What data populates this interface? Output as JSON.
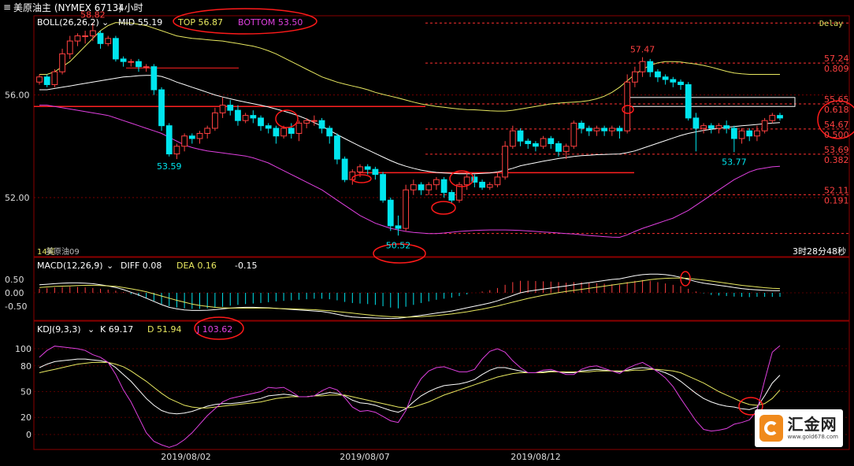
{
  "header": {
    "title": "美原油主 (NYMEX 6713)",
    "period": "4小时",
    "delay": "Delay"
  },
  "boll": {
    "label": "BOLL(26,26,2)",
    "mid": "MID 55.19",
    "top": "TOP 56.87",
    "bottom": "BOTTOM 53.50"
  },
  "macd": {
    "label": "MACD(12,26,9)",
    "diff": "DIFF 0.08",
    "dea": "DEA 0.16",
    "macd": "-0.15"
  },
  "kdj": {
    "label": "KDJ(9,3,3)",
    "k": "K 69.17",
    "d": "D 51.94",
    "j": "J 103.62"
  },
  "footer": {
    "left": "14笑",
    "contract": "美原油09",
    "countdown": "3时28分48秒"
  },
  "colors": {
    "up": "#ff4040",
    "down": "#00e5ee",
    "mid": "#ffffff",
    "top": "#e8e860",
    "bottom": "#e040e0",
    "fib": "#ff3030",
    "grid": "#7a0000"
  },
  "logo": {
    "name": "汇金网",
    "url": "www.gold678.com"
  },
  "chart_data": {
    "type": "candlestick",
    "dates": [
      "2019/08/02",
      "2019/08/07",
      "2019/08/12"
    ],
    "y_ticks": [
      "56.00",
      "52.00"
    ],
    "price_range": [
      49.7,
      58.9
    ],
    "annotations": [
      {
        "text": "58.82",
        "value": 58.82
      },
      {
        "text": "53.59",
        "value": 53.59
      },
      {
        "text": "50.52",
        "value": 50.52
      },
      {
        "text": "57.47",
        "value": 57.47
      },
      {
        "text": "53.77",
        "value": 53.77
      }
    ],
    "fib_levels": [
      {
        "price": "57.24",
        "ratio": "0.809",
        "value": 57.24
      },
      {
        "price": "55.65",
        "ratio": "0.618",
        "value": 55.65
      },
      {
        "price": "54.67",
        "ratio": "0.500",
        "value": 54.67
      },
      {
        "price": "53.69",
        "ratio": "0.382",
        "value": 53.69
      },
      {
        "price": "52.11",
        "ratio": "0.191",
        "value": 52.11
      }
    ],
    "candles": [
      [
        56.5,
        56.7,
        56.4,
        56.8
      ],
      [
        56.7,
        56.4,
        56.3,
        56.8
      ],
      [
        56.4,
        56.9,
        56.3,
        57.0
      ],
      [
        56.9,
        57.6,
        56.8,
        57.8
      ],
      [
        57.6,
        58.1,
        57.4,
        58.3
      ],
      [
        58.1,
        58.3,
        57.9,
        58.4
      ],
      [
        58.3,
        58.3,
        58.0,
        58.5
      ],
      [
        58.3,
        58.5,
        58.1,
        58.8
      ],
      [
        58.4,
        58.0,
        57.8,
        58.5
      ],
      [
        58.0,
        58.2,
        57.9,
        58.3
      ],
      [
        58.2,
        57.4,
        57.3,
        58.3
      ],
      [
        57.4,
        57.3,
        57.1,
        57.5
      ],
      [
        57.3,
        57.3,
        57.1,
        57.4
      ],
      [
        57.3,
        57.1,
        56.9,
        57.4
      ],
      [
        57.1,
        57.1,
        56.9,
        57.2
      ],
      [
        57.1,
        56.2,
        56.0,
        57.2
      ],
      [
        56.2,
        54.8,
        54.6,
        56.3
      ],
      [
        54.8,
        53.7,
        53.6,
        54.9
      ],
      [
        53.7,
        54.0,
        53.5,
        54.1
      ],
      [
        54.0,
        54.4,
        53.8,
        54.5
      ],
      [
        54.4,
        54.3,
        54.1,
        54.5
      ],
      [
        54.3,
        54.5,
        54.1,
        54.6
      ],
      [
        54.5,
        54.7,
        54.3,
        54.8
      ],
      [
        54.7,
        55.3,
        54.6,
        55.5
      ],
      [
        55.3,
        55.6,
        55.1,
        55.9
      ],
      [
        55.6,
        55.4,
        55.2,
        55.8
      ],
      [
        55.4,
        55.0,
        54.8,
        55.6
      ],
      [
        55.0,
        55.2,
        54.9,
        55.3
      ],
      [
        55.2,
        55.1,
        54.9,
        55.4
      ],
      [
        55.1,
        54.8,
        54.6,
        55.2
      ],
      [
        54.8,
        54.7,
        54.5,
        54.9
      ],
      [
        54.7,
        54.4,
        54.1,
        54.8
      ],
      [
        54.4,
        54.7,
        54.3,
        54.8
      ],
      [
        54.7,
        54.5,
        54.3,
        54.9
      ],
      [
        54.5,
        54.9,
        54.2,
        55.0
      ],
      [
        54.9,
        55.0,
        54.7,
        55.1
      ],
      [
        55.0,
        55.0,
        54.8,
        55.2
      ],
      [
        55.0,
        54.7,
        54.5,
        55.1
      ],
      [
        54.7,
        54.4,
        54.1,
        54.8
      ],
      [
        54.4,
        53.5,
        53.3,
        54.5
      ],
      [
        53.5,
        52.7,
        52.6,
        53.6
      ],
      [
        52.7,
        53.0,
        52.5,
        53.1
      ],
      [
        53.0,
        53.2,
        52.8,
        53.3
      ],
      [
        53.2,
        53.1,
        52.9,
        53.3
      ],
      [
        53.1,
        52.9,
        52.7,
        53.2
      ],
      [
        52.9,
        51.9,
        51.8,
        53.0
      ],
      [
        51.9,
        50.9,
        50.7,
        52.0
      ],
      [
        50.9,
        50.8,
        50.52,
        51.3
      ],
      [
        50.8,
        52.3,
        50.7,
        52.5
      ],
      [
        52.3,
        52.5,
        52.1,
        52.7
      ],
      [
        52.5,
        52.3,
        52.1,
        52.6
      ],
      [
        52.3,
        52.5,
        52.1,
        52.6
      ],
      [
        52.5,
        52.7,
        52.3,
        52.8
      ],
      [
        52.7,
        52.2,
        52.0,
        52.8
      ],
      [
        52.2,
        51.9,
        51.8,
        52.3
      ],
      [
        51.9,
        52.5,
        51.8,
        52.6
      ],
      [
        52.5,
        52.8,
        52.3,
        53.0
      ],
      [
        52.8,
        52.6,
        52.4,
        52.9
      ],
      [
        52.6,
        52.4,
        52.3,
        52.7
      ],
      [
        52.4,
        52.5,
        52.3,
        52.6
      ],
      [
        52.5,
        52.8,
        52.4,
        53.0
      ],
      [
        52.8,
        54.0,
        52.7,
        54.2
      ],
      [
        54.0,
        54.6,
        53.9,
        54.8
      ],
      [
        54.6,
        54.2,
        54.0,
        54.7
      ],
      [
        54.2,
        54.1,
        53.9,
        54.3
      ],
      [
        54.1,
        54.0,
        53.8,
        54.2
      ],
      [
        54.0,
        54.3,
        53.9,
        54.4
      ],
      [
        54.3,
        54.1,
        53.9,
        54.4
      ],
      [
        54.1,
        53.8,
        53.6,
        54.2
      ],
      [
        53.8,
        54.0,
        53.5,
        54.1
      ],
      [
        54.0,
        54.9,
        53.9,
        55.0
      ],
      [
        54.9,
        54.7,
        54.5,
        55.0
      ],
      [
        54.7,
        54.6,
        54.4,
        54.8
      ],
      [
        54.6,
        54.7,
        54.4,
        54.8
      ],
      [
        54.7,
        54.6,
        54.4,
        54.8
      ],
      [
        54.6,
        54.7,
        54.4,
        54.8
      ],
      [
        54.7,
        54.6,
        54.3,
        54.8
      ],
      [
        54.6,
        56.5,
        54.5,
        56.8
      ],
      [
        56.5,
        56.9,
        56.3,
        57.1
      ],
      [
        56.9,
        57.3,
        56.7,
        57.47
      ],
      [
        57.3,
        56.9,
        56.7,
        57.4
      ],
      [
        56.9,
        56.7,
        56.5,
        57.0
      ],
      [
        56.7,
        56.6,
        56.4,
        56.8
      ],
      [
        56.6,
        56.5,
        56.3,
        56.7
      ],
      [
        56.5,
        56.4,
        56.2,
        56.6
      ],
      [
        56.4,
        55.1,
        55.0,
        56.5
      ],
      [
        55.1,
        54.7,
        53.8,
        55.3
      ],
      [
        54.7,
        54.8,
        54.5,
        54.9
      ],
      [
        54.8,
        54.7,
        54.5,
        54.9
      ],
      [
        54.7,
        54.8,
        54.5,
        54.9
      ],
      [
        54.8,
        54.7,
        54.5,
        55.0
      ],
      [
        54.7,
        54.3,
        53.77,
        54.8
      ],
      [
        54.3,
        54.6,
        54.1,
        54.7
      ],
      [
        54.6,
        54.4,
        54.2,
        54.7
      ],
      [
        54.4,
        54.6,
        54.2,
        54.8
      ],
      [
        54.6,
        55.0,
        54.5,
        55.1
      ],
      [
        55.0,
        55.2,
        54.9,
        55.3
      ],
      [
        55.2,
        55.1,
        55.0,
        55.3
      ]
    ],
    "boll_mid": [
      56.2,
      56.2,
      56.25,
      56.3,
      56.35,
      56.4,
      56.45,
      56.5,
      56.55,
      56.6,
      56.65,
      56.7,
      56.72,
      56.75,
      56.76,
      56.76,
      56.72,
      56.62,
      56.5,
      56.4,
      56.3,
      56.2,
      56.1,
      56.0,
      55.92,
      55.85,
      55.78,
      55.72,
      55.66,
      55.6,
      55.53,
      55.45,
      55.37,
      55.28,
      55.18,
      55.06,
      54.92,
      54.78,
      54.62,
      54.46,
      54.3,
      54.15,
      54.0,
      53.86,
      53.72,
      53.58,
      53.44,
      53.32,
      53.22,
      53.14,
      53.07,
      53.02,
      52.98,
      52.96,
      52.94,
      52.93,
      52.93,
      52.93,
      52.94,
      52.96,
      53.0,
      53.06,
      53.14,
      53.24,
      53.3,
      53.36,
      53.42,
      53.47,
      53.52,
      53.56,
      53.6,
      53.63,
      53.65,
      53.67,
      53.68,
      53.69,
      53.7,
      53.75,
      53.82,
      53.92,
      54.02,
      54.12,
      54.22,
      54.32,
      54.42,
      54.5,
      54.56,
      54.62,
      54.66,
      54.7,
      54.74,
      54.77,
      54.8,
      54.82,
      54.85,
      54.88,
      54.9,
      54.92
    ],
    "boll_top": [
      56.8,
      56.8,
      56.9,
      57.1,
      57.3,
      57.6,
      57.9,
      58.2,
      58.5,
      58.7,
      58.82,
      58.8,
      58.8,
      58.75,
      58.7,
      58.6,
      58.5,
      58.4,
      58.3,
      58.25,
      58.2,
      58.18,
      58.15,
      58.12,
      58.1,
      58.05,
      58.0,
      57.95,
      57.9,
      57.82,
      57.72,
      57.6,
      57.45,
      57.3,
      57.15,
      57.0,
      56.85,
      56.7,
      56.6,
      56.5,
      56.42,
      56.35,
      56.28,
      56.2,
      56.1,
      56.02,
      55.95,
      55.88,
      55.8,
      55.72,
      55.65,
      55.6,
      55.55,
      55.52,
      55.48,
      55.45,
      55.43,
      55.42,
      55.4,
      55.38,
      55.37,
      55.37,
      55.4,
      55.45,
      55.5,
      55.55,
      55.6,
      55.65,
      55.68,
      55.7,
      55.72,
      55.74,
      55.78,
      55.85,
      55.95,
      56.1,
      56.3,
      56.55,
      56.8,
      57.0,
      57.15,
      57.25,
      57.3,
      57.3,
      57.28,
      57.24,
      57.2,
      57.15,
      57.08,
      57.0,
      56.92,
      56.85,
      56.82,
      56.8,
      56.8,
      56.8,
      56.8,
      56.8
    ],
    "boll_bottom": [
      55.6,
      55.6,
      55.55,
      55.5,
      55.45,
      55.4,
      55.35,
      55.3,
      55.25,
      55.2,
      55.1,
      55.0,
      54.9,
      54.8,
      54.7,
      54.6,
      54.5,
      54.35,
      54.2,
      54.05,
      53.95,
      53.88,
      53.82,
      53.78,
      53.74,
      53.7,
      53.66,
      53.62,
      53.55,
      53.45,
      53.35,
      53.2,
      53.05,
      52.9,
      52.75,
      52.6,
      52.45,
      52.3,
      52.1,
      51.9,
      51.7,
      51.5,
      51.3,
      51.15,
      51.0,
      50.9,
      50.8,
      50.74,
      50.68,
      50.64,
      50.62,
      50.6,
      50.6,
      50.62,
      50.65,
      50.68,
      50.7,
      50.72,
      50.73,
      50.74,
      50.74,
      50.74,
      50.73,
      50.72,
      50.7,
      50.68,
      50.66,
      50.64,
      50.62,
      50.6,
      50.58,
      50.55,
      50.52,
      50.5,
      50.48,
      50.46,
      50.45,
      50.55,
      50.68,
      50.8,
      50.9,
      51.0,
      51.1,
      51.2,
      51.35,
      51.5,
      51.7,
      51.9,
      52.1,
      52.3,
      52.5,
      52.7,
      52.85,
      53.0,
      53.1,
      53.15,
      53.2,
      53.22
    ],
    "macd_hist": [
      0.15,
      0.18,
      0.2,
      0.22,
      0.23,
      0.22,
      0.2,
      0.18,
      0.15,
      0.12,
      0.08,
      0.03,
      -0.05,
      -0.12,
      -0.2,
      -0.3,
      -0.42,
      -0.5,
      -0.55,
      -0.58,
      -0.6,
      -0.6,
      -0.58,
      -0.56,
      -0.52,
      -0.48,
      -0.45,
      -0.42,
      -0.4,
      -0.38,
      -0.35,
      -0.32,
      -0.3,
      -0.28,
      -0.26,
      -0.24,
      -0.22,
      -0.22,
      -0.24,
      -0.28,
      -0.34,
      -0.38,
      -0.4,
      -0.42,
      -0.45,
      -0.5,
      -0.55,
      -0.58,
      -0.52,
      -0.45,
      -0.38,
      -0.32,
      -0.26,
      -0.22,
      -0.18,
      -0.12,
      -0.06,
      0.0,
      0.05,
      0.1,
      0.18,
      0.3,
      0.4,
      0.45,
      0.45,
      0.44,
      0.43,
      0.42,
      0.4,
      0.38,
      0.4,
      0.4,
      0.38,
      0.36,
      0.34,
      0.32,
      0.3,
      0.4,
      0.45,
      0.48,
      0.45,
      0.4,
      0.35,
      0.3,
      0.25,
      0.15,
      0.05,
      -0.02,
      -0.08,
      -0.1,
      -0.12,
      -0.14,
      -0.15,
      -0.16,
      -0.15,
      -0.15,
      -0.15,
      -0.15
    ],
    "macd_diff": [
      0.3,
      0.32,
      0.34,
      0.36,
      0.37,
      0.37,
      0.36,
      0.34,
      0.3,
      0.26,
      0.2,
      0.12,
      0.02,
      -0.08,
      -0.2,
      -0.32,
      -0.44,
      -0.54,
      -0.6,
      -0.64,
      -0.66,
      -0.66,
      -0.65,
      -0.63,
      -0.6,
      -0.57,
      -0.55,
      -0.54,
      -0.54,
      -0.55,
      -0.56,
      -0.58,
      -0.6,
      -0.62,
      -0.64,
      -0.66,
      -0.68,
      -0.7,
      -0.74,
      -0.8,
      -0.86,
      -0.9,
      -0.92,
      -0.93,
      -0.94,
      -0.95,
      -0.96,
      -0.95,
      -0.92,
      -0.88,
      -0.84,
      -0.8,
      -0.76,
      -0.72,
      -0.68,
      -0.62,
      -0.56,
      -0.5,
      -0.44,
      -0.38,
      -0.3,
      -0.2,
      -0.1,
      0.0,
      0.06,
      0.1,
      0.14,
      0.18,
      0.22,
      0.26,
      0.3,
      0.34,
      0.38,
      0.42,
      0.46,
      0.5,
      0.52,
      0.58,
      0.64,
      0.68,
      0.7,
      0.7,
      0.68,
      0.64,
      0.58,
      0.5,
      0.42,
      0.36,
      0.32,
      0.28,
      0.24,
      0.2,
      0.16,
      0.13,
      0.11,
      0.09,
      0.08,
      0.08
    ],
    "macd_dea": [
      0.2,
      0.22,
      0.24,
      0.25,
      0.26,
      0.27,
      0.28,
      0.28,
      0.27,
      0.26,
      0.24,
      0.2,
      0.15,
      0.1,
      0.04,
      -0.04,
      -0.12,
      -0.2,
      -0.28,
      -0.35,
      -0.42,
      -0.47,
      -0.51,
      -0.54,
      -0.56,
      -0.57,
      -0.57,
      -0.57,
      -0.57,
      -0.57,
      -0.57,
      -0.58,
      -0.59,
      -0.6,
      -0.61,
      -0.62,
      -0.63,
      -0.65,
      -0.67,
      -0.7,
      -0.73,
      -0.76,
      -0.79,
      -0.82,
      -0.85,
      -0.87,
      -0.89,
      -0.9,
      -0.91,
      -0.9,
      -0.89,
      -0.87,
      -0.85,
      -0.82,
      -0.79,
      -0.75,
      -0.71,
      -0.66,
      -0.61,
      -0.55,
      -0.49,
      -0.42,
      -0.35,
      -0.28,
      -0.21,
      -0.15,
      -0.09,
      -0.04,
      0.01,
      0.05,
      0.09,
      0.13,
      0.17,
      0.21,
      0.25,
      0.29,
      0.33,
      0.37,
      0.41,
      0.45,
      0.49,
      0.52,
      0.54,
      0.55,
      0.55,
      0.54,
      0.51,
      0.48,
      0.44,
      0.4,
      0.36,
      0.32,
      0.28,
      0.25,
      0.22,
      0.19,
      0.17,
      0.16
    ],
    "kdj_k": [
      78,
      82,
      85,
      86,
      87,
      88,
      88,
      87,
      86,
      84,
      78,
      70,
      62,
      52,
      42,
      34,
      28,
      25,
      24,
      25,
      27,
      30,
      33,
      35,
      36,
      36,
      37,
      38,
      40,
      42,
      45,
      46,
      47,
      46,
      44,
      44,
      45,
      47,
      49,
      48,
      45,
      40,
      37,
      36,
      34,
      31,
      28,
      26,
      30,
      38,
      45,
      50,
      54,
      57,
      58,
      59,
      61,
      64,
      70,
      75,
      78,
      78,
      76,
      74,
      72,
      72,
      73,
      74,
      73,
      72,
      72,
      74,
      75,
      76,
      75,
      74,
      73,
      75,
      77,
      78,
      77,
      75,
      72,
      68,
      62,
      55,
      48,
      42,
      38,
      35,
      33,
      32,
      30,
      29,
      32,
      45,
      60,
      69.17
    ],
    "kdj_d": [
      72,
      74,
      76,
      78,
      80,
      82,
      83,
      84,
      84,
      84,
      82,
      79,
      74,
      68,
      62,
      55,
      48,
      42,
      38,
      34,
      32,
      31,
      31,
      32,
      33,
      34,
      35,
      36,
      37,
      38,
      40,
      42,
      43,
      44,
      44,
      44,
      45,
      45,
      46,
      46,
      46,
      44,
      42,
      40,
      38,
      36,
      34,
      32,
      31,
      32,
      35,
      38,
      42,
      46,
      49,
      52,
      55,
      58,
      61,
      64,
      67,
      69,
      71,
      72,
      72,
      72,
      72,
      73,
      73,
      73,
      73,
      73,
      73,
      74,
      74,
      74,
      74,
      74,
      75,
      75,
      76,
      76,
      75,
      74,
      72,
      68,
      64,
      60,
      55,
      50,
      46,
      42,
      38,
      35,
      34,
      36,
      42,
      51.94
    ],
    "kdj_j": [
      90,
      98,
      103,
      102,
      101,
      100,
      98,
      93,
      90,
      84,
      70,
      52,
      38,
      20,
      2,
      -8,
      -12,
      -15,
      -12,
      -6,
      2,
      12,
      22,
      30,
      38,
      42,
      44,
      46,
      48,
      50,
      55,
      54,
      55,
      50,
      44,
      44,
      45,
      51,
      55,
      52,
      43,
      32,
      27,
      28,
      26,
      21,
      16,
      14,
      28,
      50,
      65,
      74,
      78,
      79,
      76,
      73,
      73,
      76,
      88,
      97,
      100,
      96,
      86,
      78,
      72,
      72,
      75,
      76,
      73,
      70,
      70,
      76,
      79,
      80,
      77,
      74,
      71,
      77,
      81,
      84,
      79,
      73,
      66,
      56,
      42,
      29,
      16,
      6,
      4,
      5,
      7,
      12,
      14,
      17,
      28,
      63,
      96,
      103.62
    ]
  }
}
